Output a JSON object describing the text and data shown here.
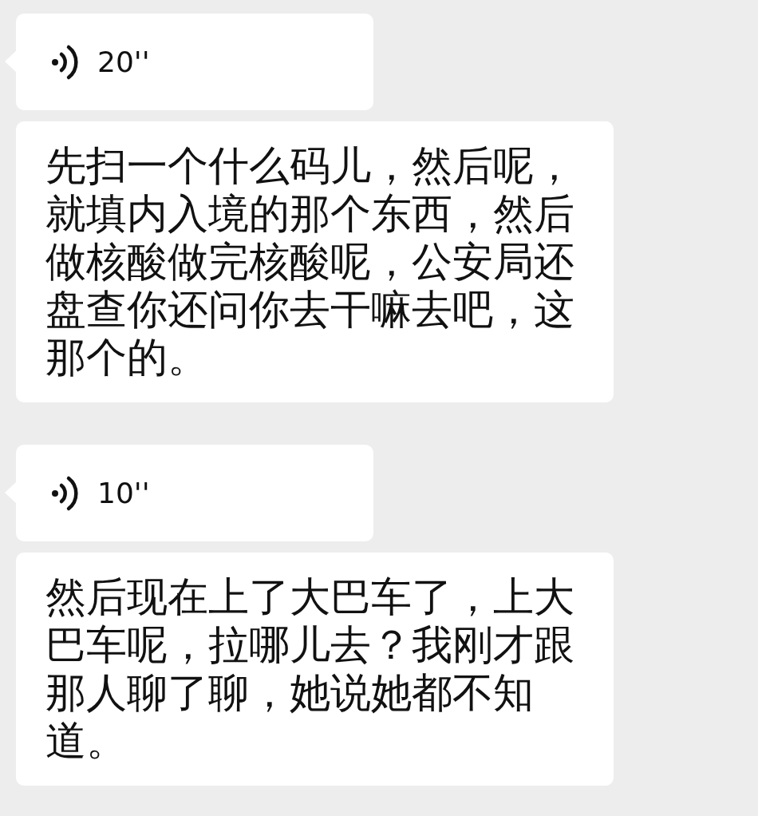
{
  "messages": [
    {
      "kind": "voice",
      "duration": "20''"
    },
    {
      "kind": "text",
      "text": "先扫一个什么码儿，然后呢，就填内入境的那个东西，然后做核酸做完核酸呢，公安局还盘查你还问你去干嘛去吧，这那个的。"
    },
    {
      "kind": "voice",
      "duration": "10''"
    },
    {
      "kind": "text",
      "text": "然后现在上了大巴车了，上大巴车呢，拉哪儿去？我刚才跟那人聊了聊，她说她都不知道。"
    }
  ]
}
